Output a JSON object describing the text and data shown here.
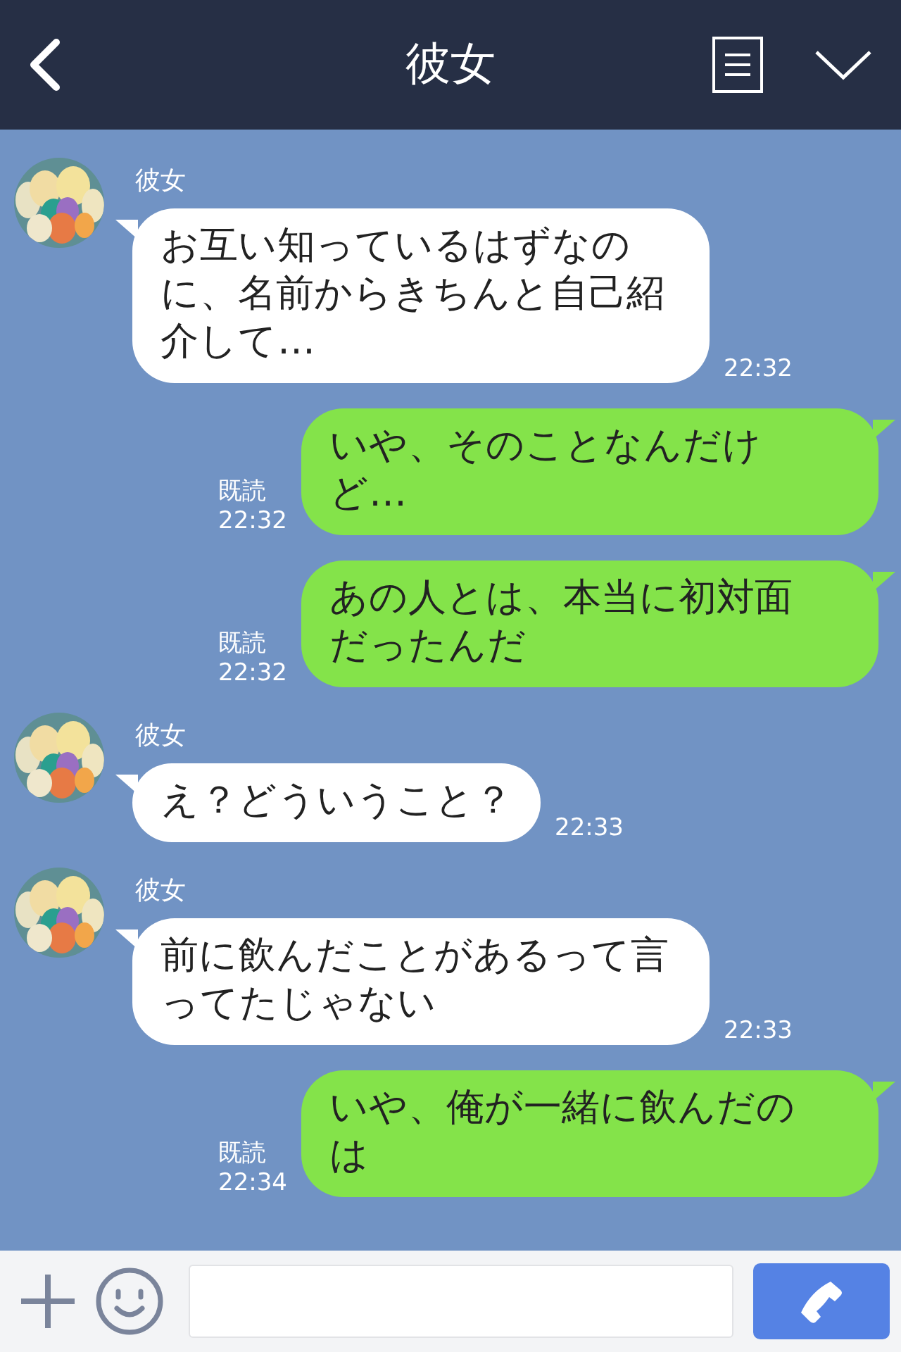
{
  "header": {
    "title": "彼女"
  },
  "messages": [
    {
      "kind": "received",
      "sender": "彼女",
      "text": "お互い知っているはずなのに、名前からきちんと自己紹介して…",
      "time": "22:32"
    },
    {
      "kind": "sent",
      "read": "既読",
      "text": "いや、そのことなんだけど…",
      "time": "22:32"
    },
    {
      "kind": "sent",
      "read": "既読",
      "text": "あの人とは、本当に初対面だったんだ",
      "time": "22:32"
    },
    {
      "kind": "received",
      "sender": "彼女",
      "text": "え？どういうこと？",
      "time": "22:33"
    },
    {
      "kind": "received",
      "sender": "彼女",
      "text": "前に飲んだことがあるって言ってたじゃない",
      "time": "22:33"
    },
    {
      "kind": "sent",
      "read": "既読",
      "text": "いや、俺が一緒に飲んだのは",
      "time": "22:34"
    }
  ]
}
